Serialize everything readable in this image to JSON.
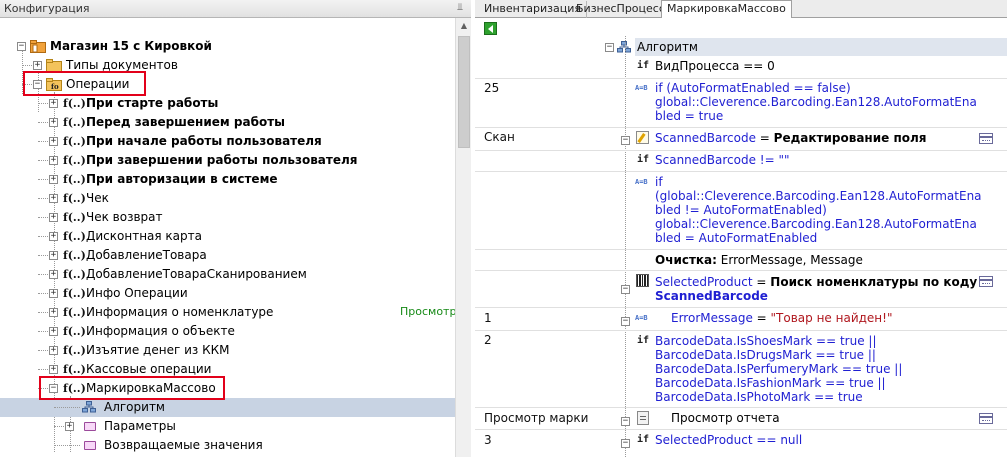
{
  "left_panel": {
    "title": "Конфигурация",
    "pin_icon": "pin-icon",
    "tree": [
      {
        "label": "Магазин 15 с Кировкой",
        "bold": true
      },
      {
        "label": "Типы документов",
        "bold": false
      },
      {
        "label": "Операции",
        "bold": false
      },
      {
        "label": "При старте работы",
        "bold": true
      },
      {
        "label": "Перед завершением работы",
        "bold": true
      },
      {
        "label": "При начале работы пользователя",
        "bold": true
      },
      {
        "label": "При завершении работы пользователя",
        "bold": true
      },
      {
        "label": "При авторизации в системе",
        "bold": true
      },
      {
        "label": "Чек",
        "bold": false
      },
      {
        "label": "Чек возврат",
        "bold": false
      },
      {
        "label": "Дисконтная карта",
        "bold": false
      },
      {
        "label": "ДобавлениеТовара",
        "bold": false
      },
      {
        "label": "ДобавлениеТовараСканированием",
        "bold": false
      },
      {
        "label": "Инфо Операции",
        "bold": false
      },
      {
        "label": "Информация о номенклатуре",
        "bold": false
      },
      {
        "label": "Информация о объекте",
        "bold": false
      },
      {
        "label": "Изъятие денег из ККМ",
        "bold": false
      },
      {
        "label": "Кассовые операции",
        "bold": false
      },
      {
        "label": "МаркировкаМассово",
        "bold": false
      },
      {
        "label": "Алгоритм",
        "bold": false
      },
      {
        "label": "Параметры",
        "bold": false
      },
      {
        "label": "Возвращаемые значения",
        "bold": false
      }
    ],
    "fx_label": "f(..)",
    "green_text": "Просмотр"
  },
  "right_panel": {
    "tabs": [
      "Инвентаризация",
      "БизнесПроцессы",
      "МаркировкаМассово"
    ],
    "active_tab": "МаркировкаМассово",
    "algo_header": "Алгоритм",
    "rows": {
      "r1": {
        "label": "",
        "prefix": "if",
        "text": "ВидПроцесса == 0"
      },
      "r2": {
        "label": "25",
        "l1": "if (AutoFormatEnabled == false)",
        "l2": "global::Cleverence.Barcoding.Ean128.AutoFormatEna",
        "l3": "bled = true"
      },
      "r3": {
        "label": "Скан",
        "var": "ScannedBarcode",
        "eq": " = ",
        "bold": "Редактирование поля"
      },
      "r4": {
        "label": "",
        "text": "ScannedBarcode != \"\""
      },
      "r5": {
        "label": "",
        "l1": "if",
        "l2": "(global::Cleverence.Barcoding.Ean128.AutoFormatEna",
        "l3": "bled != AutoFormatEnabled)",
        "l4": "global::Cleverence.Barcoding.Ean128.AutoFormatEna",
        "l5": "bled = AutoFormatEnabled"
      },
      "r6": {
        "label": "",
        "bold": "Очистка:",
        "text": " ErrorMessage, Message"
      },
      "r7": {
        "label": "",
        "var": "SelectedProduct",
        "eq": " = ",
        "bold": "Поиск номенклатуры по коду",
        "bold2": "ScannedBarcode"
      },
      "r8": {
        "label": "1",
        "var": "ErrorMessage",
        "eq": " = ",
        "str": "\"Товар не найден!\""
      },
      "r9": {
        "label": "2",
        "lines": [
          "BarcodeData.IsShoesMark == true ||",
          "BarcodeData.IsDrugsMark == true ||",
          "BarcodeData.IsPerfumeryMark == true ||",
          "BarcodeData.IsFashionMark == true ||",
          "BarcodeData.IsPhotoMark == true"
        ]
      },
      "r10": {
        "label": "Просмотр марки",
        "text": "Просмотр отчета"
      },
      "r11": {
        "label": "3",
        "text": "SelectedProduct == null"
      }
    },
    "prefix_if": "if",
    "prefix_ab": "A=B"
  },
  "colors": {
    "highlight_red": "#e2001a",
    "selection": "#c8d3e3",
    "keyword_blue": "#1f1fd2",
    "string_red": "#b0171e",
    "green_button": "#2ea12e"
  }
}
